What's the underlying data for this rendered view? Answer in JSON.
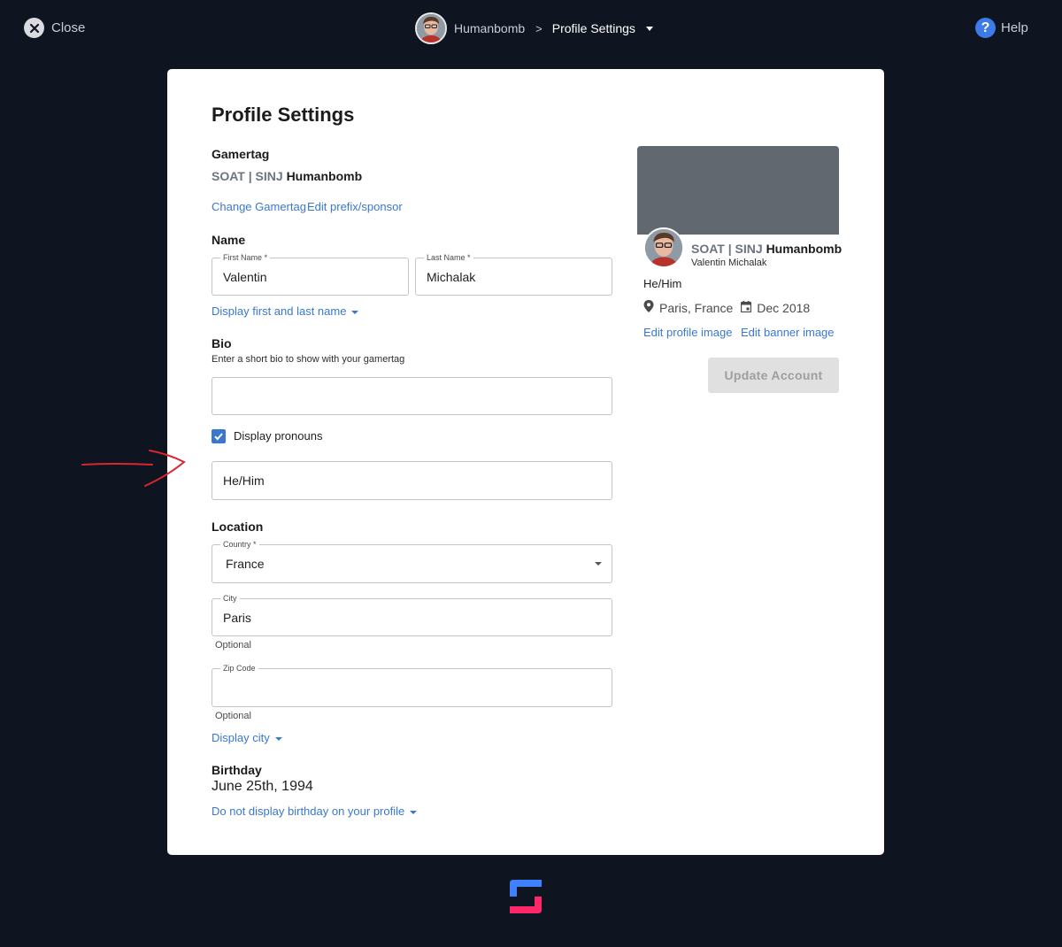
{
  "topbar": {
    "close_label": "Close",
    "user": "Humanbomb",
    "separator": ">",
    "current_page": "Profile Settings",
    "help_label": "Help"
  },
  "card": {
    "title": "Profile Settings",
    "gamertag": {
      "label": "Gamertag",
      "prefix": "SOAT | SINJ",
      "name": "Humanbomb",
      "change_link": "Change Gamertag",
      "edit_prefix_link": "Edit prefix/sponsor"
    },
    "name": {
      "label": "Name",
      "first_label": "First Name *",
      "first_value": "Valentin",
      "last_label": "Last Name *",
      "last_value": "Michalak",
      "display_option": "Display first and last name"
    },
    "bio": {
      "label": "Bio",
      "hint": "Enter a short bio to show with your gamertag",
      "value": ""
    },
    "pronouns": {
      "checkbox_label": "Display pronouns",
      "checked": true,
      "value": "He/Him"
    },
    "location": {
      "label": "Location",
      "country_label": "Country *",
      "country_value": "France",
      "city_label": "City",
      "city_value": "Paris",
      "city_helper": "Optional",
      "zip_label": "Zip Code",
      "zip_value": "",
      "zip_helper": "Optional",
      "display_option": "Display city"
    },
    "birthday": {
      "label": "Birthday",
      "value": "June 25th, 1994",
      "display_option": "Do not display birthday on your profile"
    }
  },
  "preview": {
    "prefix": "SOAT | SINJ",
    "gamertag": "Humanbomb",
    "full_name": "Valentin Michalak",
    "pronouns": "He/Him",
    "location": "Paris, France",
    "joined": "Dec 2018",
    "edit_profile_image": "Edit profile image",
    "edit_banner_image": "Edit banner image",
    "update_button": "Update Account"
  },
  "colors": {
    "background": "#0e1521",
    "link": "#3a78d0",
    "banner": "#62686f",
    "annotation": "#d9262d"
  }
}
